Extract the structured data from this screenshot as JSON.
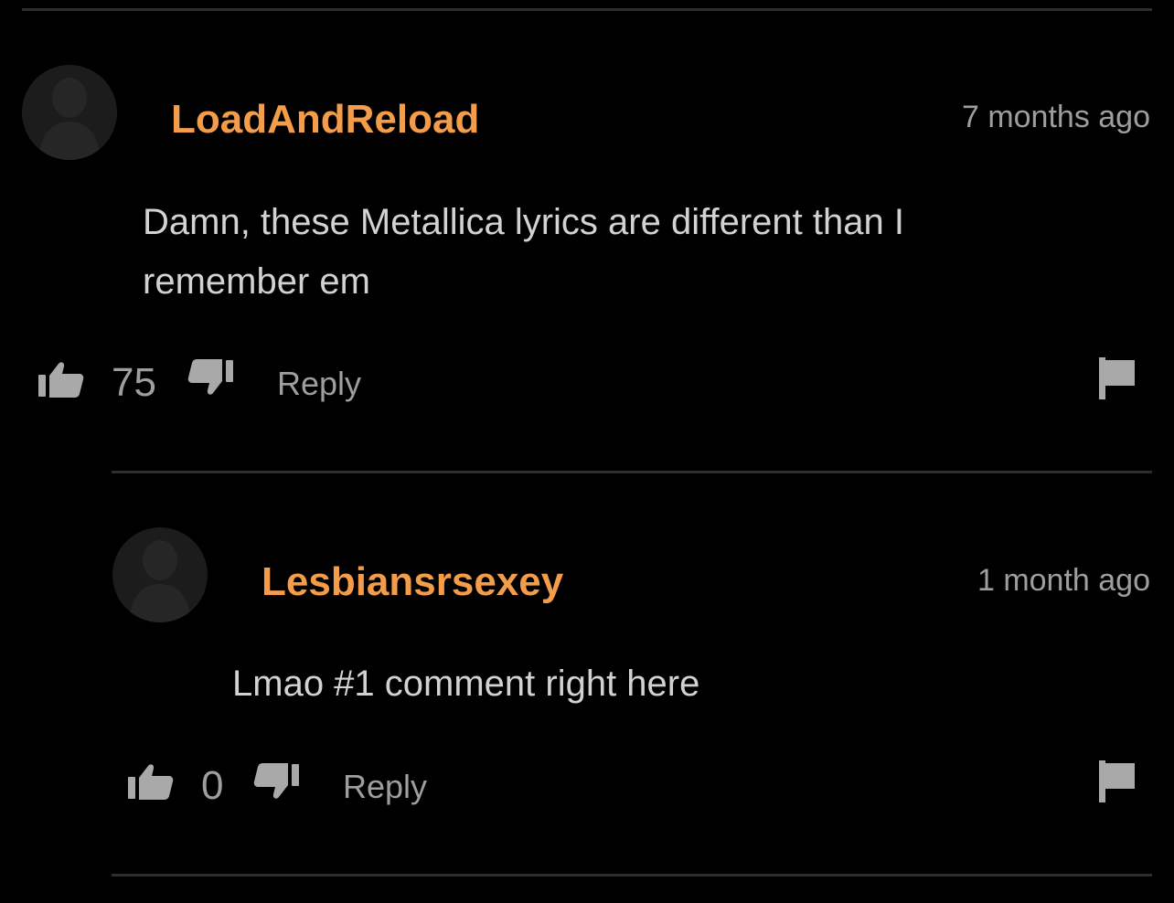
{
  "comments": [
    {
      "username": "LoadAndReload",
      "timestamp": "7 months ago",
      "text": "Damn, these Metallica lyrics are different than I remember em",
      "likes": "75",
      "reply_label": "Reply"
    },
    {
      "username": "Lesbiansrsexey",
      "timestamp": "1 month ago",
      "text": "Lmao #1 comment right here",
      "likes": "0",
      "reply_label": "Reply"
    }
  ],
  "colors": {
    "background": "#000000",
    "username": "#f39c4a",
    "meta_text": "#9e9e9e",
    "body_text": "#d2d2d2",
    "divider": "#2e2e2e",
    "avatar_bg": "#1c1c1c"
  },
  "icons": [
    "avatar-placeholder-icon",
    "thumbs-up-icon",
    "thumbs-down-icon",
    "flag-icon"
  ]
}
